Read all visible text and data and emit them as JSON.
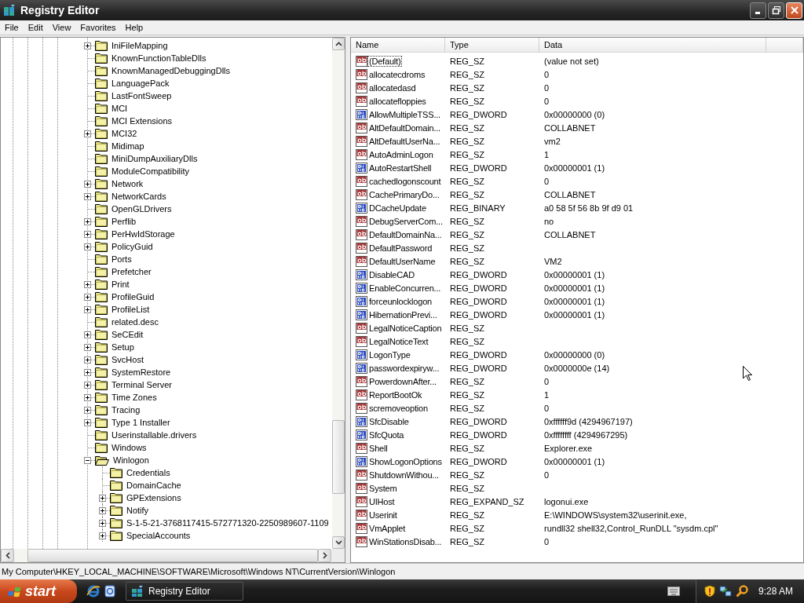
{
  "window": {
    "title": "Registry Editor"
  },
  "menu": [
    "File",
    "Edit",
    "View",
    "Favorites",
    "Help"
  ],
  "tree": [
    {
      "label": "IniFileMapping",
      "has_children": true,
      "expanded": false
    },
    {
      "label": "KnownFunctionTableDlls",
      "has_children": false,
      "expanded": false
    },
    {
      "label": "KnownManagedDebuggingDlls",
      "has_children": false,
      "expanded": false
    },
    {
      "label": "LanguagePack",
      "has_children": false,
      "expanded": false
    },
    {
      "label": "LastFontSweep",
      "has_children": false,
      "expanded": false
    },
    {
      "label": "MCI",
      "has_children": false,
      "expanded": false
    },
    {
      "label": "MCI Extensions",
      "has_children": false,
      "expanded": false
    },
    {
      "label": "MCI32",
      "has_children": true,
      "expanded": false
    },
    {
      "label": "Midimap",
      "has_children": false,
      "expanded": false
    },
    {
      "label": "MiniDumpAuxiliaryDlls",
      "has_children": false,
      "expanded": false
    },
    {
      "label": "ModuleCompatibility",
      "has_children": false,
      "expanded": false
    },
    {
      "label": "Network",
      "has_children": true,
      "expanded": false
    },
    {
      "label": "NetworkCards",
      "has_children": true,
      "expanded": false
    },
    {
      "label": "OpenGLDrivers",
      "has_children": false,
      "expanded": false
    },
    {
      "label": "Perflib",
      "has_children": true,
      "expanded": false
    },
    {
      "label": "PerHwIdStorage",
      "has_children": true,
      "expanded": false
    },
    {
      "label": "PolicyGuid",
      "has_children": true,
      "expanded": false
    },
    {
      "label": "Ports",
      "has_children": false,
      "expanded": false
    },
    {
      "label": "Prefetcher",
      "has_children": false,
      "expanded": false
    },
    {
      "label": "Print",
      "has_children": true,
      "expanded": false
    },
    {
      "label": "ProfileGuid",
      "has_children": true,
      "expanded": false
    },
    {
      "label": "ProfileList",
      "has_children": true,
      "expanded": false
    },
    {
      "label": "related.desc",
      "has_children": false,
      "expanded": false
    },
    {
      "label": "SeCEdit",
      "has_children": true,
      "expanded": false
    },
    {
      "label": "Setup",
      "has_children": true,
      "expanded": false
    },
    {
      "label": "SvcHost",
      "has_children": true,
      "expanded": false
    },
    {
      "label": "SystemRestore",
      "has_children": true,
      "expanded": false
    },
    {
      "label": "Terminal Server",
      "has_children": true,
      "expanded": false
    },
    {
      "label": "Time Zones",
      "has_children": true,
      "expanded": false
    },
    {
      "label": "Tracing",
      "has_children": true,
      "expanded": false
    },
    {
      "label": "Type 1 Installer",
      "has_children": true,
      "expanded": false
    },
    {
      "label": "Userinstallable.drivers",
      "has_children": false,
      "expanded": false
    },
    {
      "label": "Windows",
      "has_children": false,
      "expanded": false
    },
    {
      "label": "Winlogon",
      "has_children": true,
      "expanded": true,
      "children": [
        {
          "label": "Credentials",
          "has_children": false,
          "expanded": false
        },
        {
          "label": "DomainCache",
          "has_children": false,
          "expanded": false
        },
        {
          "label": "GPExtensions",
          "has_children": true,
          "expanded": false
        },
        {
          "label": "Notify",
          "has_children": true,
          "expanded": false
        },
        {
          "label": "S-1-5-21-3768117415-572771320-2250989607-1109",
          "has_children": true,
          "expanded": false
        },
        {
          "label": "SpecialAccounts",
          "has_children": true,
          "expanded": false
        }
      ]
    }
  ],
  "list": {
    "columns": [
      "Name",
      "Type",
      "Data"
    ],
    "rows": [
      {
        "kind": "string",
        "name": "(Default)",
        "type": "REG_SZ",
        "data": "(value not set)",
        "focused": true
      },
      {
        "kind": "string",
        "name": "allocatecdroms",
        "type": "REG_SZ",
        "data": "0",
        "focused": false
      },
      {
        "kind": "string",
        "name": "allocatedasd",
        "type": "REG_SZ",
        "data": "0",
        "focused": false
      },
      {
        "kind": "string",
        "name": "allocatefloppies",
        "type": "REG_SZ",
        "data": "0",
        "focused": false
      },
      {
        "kind": "binary",
        "name": "AllowMultipleTSS...",
        "type": "REG_DWORD",
        "data": "0x00000000 (0)",
        "focused": false
      },
      {
        "kind": "string",
        "name": "AltDefaultDomain...",
        "type": "REG_SZ",
        "data": "COLLABNET",
        "focused": false
      },
      {
        "kind": "string",
        "name": "AltDefaultUserNa...",
        "type": "REG_SZ",
        "data": "vm2",
        "focused": false
      },
      {
        "kind": "string",
        "name": "AutoAdminLogon",
        "type": "REG_SZ",
        "data": "1",
        "focused": false
      },
      {
        "kind": "binary",
        "name": "AutoRestartShell",
        "type": "REG_DWORD",
        "data": "0x00000001 (1)",
        "focused": false
      },
      {
        "kind": "string",
        "name": "cachedlogonscount",
        "type": "REG_SZ",
        "data": "0",
        "focused": false
      },
      {
        "kind": "string",
        "name": "CachePrimaryDo...",
        "type": "REG_SZ",
        "data": "COLLABNET",
        "focused": false
      },
      {
        "kind": "binary",
        "name": "DCacheUpdate",
        "type": "REG_BINARY",
        "data": "a0 58 5f 56 8b 9f d9 01",
        "focused": false
      },
      {
        "kind": "string",
        "name": "DebugServerCom...",
        "type": "REG_SZ",
        "data": "no",
        "focused": false
      },
      {
        "kind": "string",
        "name": "DefaultDomainNa...",
        "type": "REG_SZ",
        "data": "COLLABNET",
        "focused": false
      },
      {
        "kind": "string",
        "name": "DefaultPassword",
        "type": "REG_SZ",
        "focused": false
      },
      {
        "kind": "string",
        "name": "DefaultUserName",
        "type": "REG_SZ",
        "data": "VM2",
        "focused": false
      },
      {
        "kind": "binary",
        "name": "DisableCAD",
        "type": "REG_DWORD",
        "data": "0x00000001 (1)",
        "focused": false
      },
      {
        "kind": "binary",
        "name": "EnableConcurren...",
        "type": "REG_DWORD",
        "data": "0x00000001 (1)",
        "focused": false
      },
      {
        "kind": "binary",
        "name": "forceunlocklogon",
        "type": "REG_DWORD",
        "data": "0x00000001 (1)",
        "focused": false
      },
      {
        "kind": "binary",
        "name": "HibernationPrevi...",
        "type": "REG_DWORD",
        "data": "0x00000001 (1)",
        "focused": false
      },
      {
        "kind": "string",
        "name": "LegalNoticeCaption",
        "type": "REG_SZ",
        "focused": false
      },
      {
        "kind": "string",
        "name": "LegalNoticeText",
        "type": "REG_SZ",
        "focused": false
      },
      {
        "kind": "binary",
        "name": "LogonType",
        "type": "REG_DWORD",
        "data": "0x00000000 (0)",
        "focused": false
      },
      {
        "kind": "binary",
        "name": "passwordexpiryw...",
        "type": "REG_DWORD",
        "data": "0x0000000e (14)",
        "focused": false
      },
      {
        "kind": "string",
        "name": "PowerdownAfter...",
        "type": "REG_SZ",
        "data": "0",
        "focused": false
      },
      {
        "kind": "string",
        "name": "ReportBootOk",
        "type": "REG_SZ",
        "data": "1",
        "focused": false
      },
      {
        "kind": "string",
        "name": "scremoveoption",
        "type": "REG_SZ",
        "data": "0",
        "focused": false
      },
      {
        "kind": "binary",
        "name": "SfcDisable",
        "type": "REG_DWORD",
        "data": "0xffffff9d (4294967197)",
        "focused": false
      },
      {
        "kind": "binary",
        "name": "SfcQuota",
        "type": "REG_DWORD",
        "data": "0xffffffff (4294967295)",
        "focused": false
      },
      {
        "kind": "string",
        "name": "Shell",
        "type": "REG_SZ",
        "data": "Explorer.exe",
        "focused": false
      },
      {
        "kind": "binary",
        "name": "ShowLogonOptions",
        "type": "REG_DWORD",
        "data": "0x00000001 (1)",
        "focused": false
      },
      {
        "kind": "string",
        "name": "ShutdownWithou...",
        "type": "REG_SZ",
        "data": "0",
        "focused": false
      },
      {
        "kind": "string",
        "name": "System",
        "type": "REG_SZ",
        "focused": false
      },
      {
        "kind": "string",
        "name": "UIHost",
        "type": "REG_EXPAND_SZ",
        "data": "logonui.exe",
        "focused": false
      },
      {
        "kind": "string",
        "name": "Userinit",
        "type": "REG_SZ",
        "data": "E:\\WINDOWS\\system32\\userinit.exe,",
        "focused": false
      },
      {
        "kind": "string",
        "name": "VmApplet",
        "type": "REG_SZ",
        "data": "rundll32 shell32,Control_RunDLL \"sysdm.cpl\"",
        "focused": false
      },
      {
        "kind": "string",
        "name": "WinStationsDisab...",
        "type": "REG_SZ",
        "data": "0",
        "focused": false
      }
    ]
  },
  "status_bar": "My Computer\\HKEY_LOCAL_MACHINE\\SOFTWARE\\Microsoft\\Windows NT\\CurrentVersion\\Winlogon",
  "taskbar": {
    "start": "start",
    "tasks": [
      {
        "label": "Registry Editor",
        "selected": false
      }
    ],
    "clock": "9:28 AM"
  }
}
